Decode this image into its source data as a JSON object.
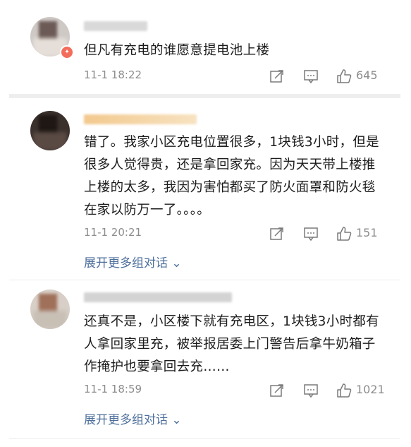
{
  "comments": [
    {
      "text": "但凡有充电的谁愿意提电池上楼",
      "time": "11-1 18:22",
      "likes": "645"
    },
    {
      "text": "错了。我家小区充电位置很多，1块钱3小时，但是很多人觉得贵，还是拿回家充。因为天天带上楼推上楼的太多，我因为害怕都买了防火面罩和防火毯在家以防万一了。。。。",
      "time": "11-1 20:21",
      "likes": "151",
      "expand_label": "展开更多组对话"
    },
    {
      "text": "还真不是，小区楼下就有充电区，1块钱3小时都有人拿回家里充，被举报居委上门警告后拿牛奶箱子作掩护也要拿回去充……",
      "time": "11-1 18:59",
      "likes": "1021",
      "expand_label": "展开更多组对话"
    }
  ],
  "icons": [
    "share-icon",
    "comment-icon",
    "like-icon",
    "chevron-down-icon"
  ],
  "colors": {
    "link": "#4d6f9c",
    "meta": "#8c8c8c",
    "badge": "#f26d5b",
    "name_highlight": "#f6d8a8"
  }
}
